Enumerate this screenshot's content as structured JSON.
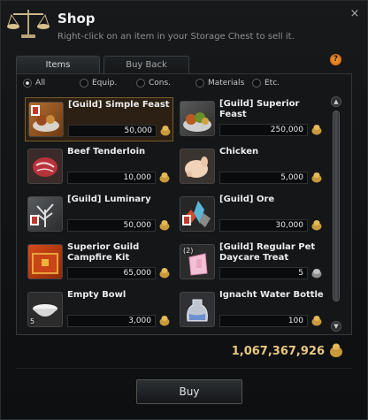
{
  "window": {
    "title": "Shop",
    "subtitle": "Right-click on an item in your Storage Chest to sell it.",
    "close_label": "×",
    "help_label": "?"
  },
  "tabs": [
    {
      "label": "Items",
      "active": true
    },
    {
      "label": "Buy Back",
      "active": false
    }
  ],
  "filters": [
    {
      "label": "All",
      "selected": true
    },
    {
      "label": "Equip.",
      "selected": false
    },
    {
      "label": "Cons.",
      "selected": false
    },
    {
      "label": "Materials",
      "selected": false
    },
    {
      "label": "Etc.",
      "selected": false
    }
  ],
  "items": [
    {
      "name": "[Guild] Simple Feast",
      "price": "50,000",
      "icon": "simple-feast-icon",
      "selected": true
    },
    {
      "name": "[Guild] Superior Feast",
      "price": "250,000",
      "icon": "superior-feast-icon"
    },
    {
      "name": "Beef Tenderloin",
      "price": "10,000",
      "icon": "beef-icon"
    },
    {
      "name": "Chicken",
      "price": "5,000",
      "icon": "chicken-icon"
    },
    {
      "name": "[Guild] Luminary",
      "price": "50,000",
      "icon": "luminary-icon"
    },
    {
      "name": "[Guild] Ore",
      "price": "30,000",
      "icon": "ore-icon"
    },
    {
      "name": "Superior Guild Campfire Kit",
      "price": "65,000",
      "icon": "campfire-kit-icon"
    },
    {
      "name": "[Guild] Regular Pet Daycare Treat",
      "price": "5",
      "icon": "pet-treat-icon",
      "badge": "(2)"
    },
    {
      "name": "Empty Bowl",
      "price": "3,000",
      "icon": "bowl-icon",
      "badge": "5"
    },
    {
      "name": "Ignacht Water Bottle",
      "price": "100",
      "icon": "water-bottle-icon"
    }
  ],
  "silver": "1,067,367,926",
  "buy_label": "Buy",
  "colors": {
    "accent": "#e9c77f",
    "selected_border": "#7a5b2c"
  }
}
